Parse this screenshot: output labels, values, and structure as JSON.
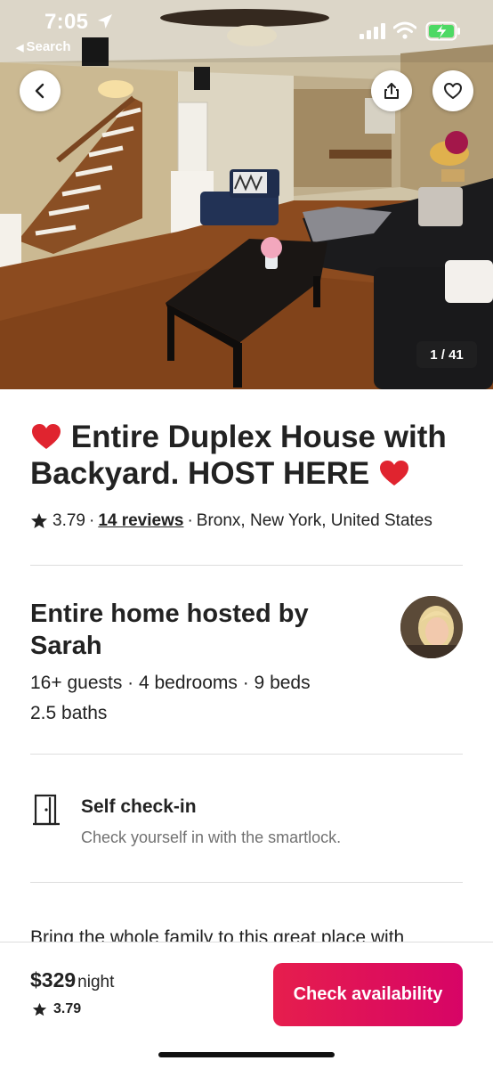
{
  "status_bar": {
    "time": "7:05",
    "back_app": "Search"
  },
  "hero": {
    "photo_counter": "1 / 41",
    "back_button_icon": "chevron-left-icon",
    "share_button_icon": "share-icon",
    "favorite_button_icon": "heart-outline-icon"
  },
  "listing": {
    "title": "Entire Duplex House with Backyard. HOST HERE",
    "title_emoji": "heart-emoji",
    "rating": "3.79",
    "reviews_link": "14 reviews",
    "location": "Bronx, New York, United States"
  },
  "host": {
    "heading": "Entire home hosted by Sarah",
    "specs_line1": "16+ guests · 4 bedrooms · 9 beds",
    "specs_line2": "2.5 baths"
  },
  "feature": {
    "icon": "door-icon",
    "title": "Self check-in",
    "description": "Check yourself in with the smartlock."
  },
  "description_preview": "Bring the whole family to this great place with",
  "footer": {
    "price": "$329",
    "price_unit": "night",
    "rating": "3.79",
    "cta_label": "Check availability"
  },
  "colors": {
    "accent": "#E61E4D",
    "text": "#222222",
    "muted": "#717171",
    "divider": "#DDDDDD"
  }
}
